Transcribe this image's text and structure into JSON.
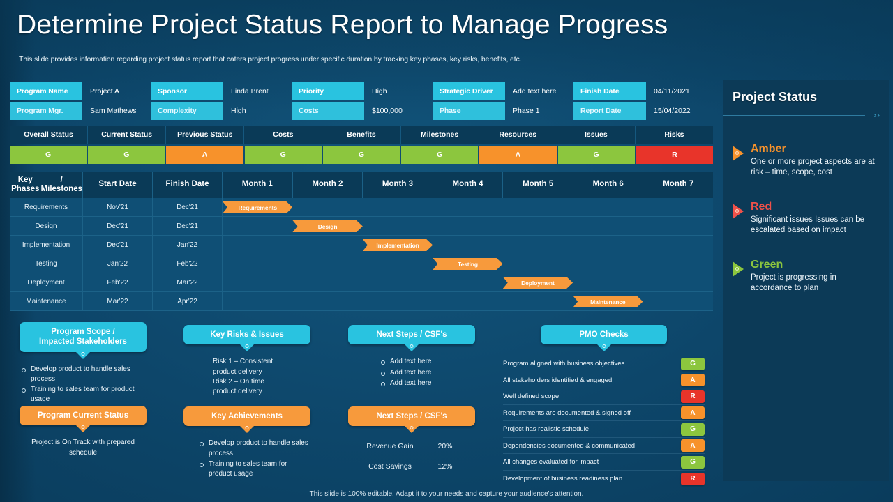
{
  "header": {
    "title": "Determine Project Status Report to Manage Progress",
    "subtitle": "This slide provides information regarding project status report that caters project progress under specific duration by tracking key phases, key risks, benefits, etc."
  },
  "info_strip": {
    "row1": [
      {
        "label": "Program Name",
        "value": "Project A"
      },
      {
        "label": "Sponsor",
        "value": "Linda Brent"
      },
      {
        "label": "Priority",
        "value": "High"
      },
      {
        "label": "Strategic Driver",
        "value": "Add text here"
      },
      {
        "label": "Finish Date",
        "value": "04/11/2021"
      }
    ],
    "row2": [
      {
        "label": "Program Mgr.",
        "value": "Sam Mathews"
      },
      {
        "label": "Complexity",
        "value": "High"
      },
      {
        "label": "Costs",
        "value": "$100,000"
      },
      {
        "label": "Phase",
        "value": "Phase 1"
      },
      {
        "label": "Report Date",
        "value": "15/04/2022"
      }
    ]
  },
  "status_table": {
    "headers": [
      "Overall Status",
      "Current Status",
      "Previous Status",
      "Costs",
      "Benefits",
      "Milestones",
      "Resources",
      "Issues",
      "Risks"
    ],
    "values": [
      "G",
      "G",
      "A",
      "G",
      "G",
      "G",
      "A",
      "G",
      "R"
    ]
  },
  "gantt": {
    "headers": [
      "Key Phases\n/ Milestones",
      "Start Date",
      "Finish Date",
      "Month 1",
      "Month 2",
      "Month 3",
      "Month 4",
      "Month 5",
      "Month 6",
      "Month 7"
    ],
    "phase_header_line1": "Key Phases",
    "phase_header_line2": "/ Milestones",
    "rows": [
      {
        "phase": "Requirements",
        "start": "Nov'21",
        "finish": "Dec'21",
        "bar_label": "Requirements",
        "bar_start_month": 1,
        "bar_span": 1
      },
      {
        "phase": "Design",
        "start": "Dec'21",
        "finish": "Dec'21",
        "bar_label": "Design",
        "bar_start_month": 2,
        "bar_span": 1
      },
      {
        "phase": "Implementation",
        "start": "Dec'21",
        "finish": "Jan'22",
        "bar_label": "Implementation",
        "bar_start_month": 3,
        "bar_span": 1
      },
      {
        "phase": "Testing",
        "start": "Jan'22",
        "finish": "Feb'22",
        "bar_label": "Testing",
        "bar_start_month": 4,
        "bar_span": 1
      },
      {
        "phase": "Deployment",
        "start": "Feb'22",
        "finish": "Mar'22",
        "bar_label": "Deployment",
        "bar_start_month": 5,
        "bar_span": 1
      },
      {
        "phase": "Maintenance",
        "start": "Mar'22",
        "finish": "Apr'22",
        "bar_label": "Maintenance",
        "bar_start_month": 6,
        "bar_span": 1
      }
    ]
  },
  "cards": {
    "program_scope": {
      "title": "Program Scope /\nImpacted Stakeholders",
      "title_line1": "Program Scope /",
      "title_line2": "Impacted Stakeholders",
      "items": [
        "Develop product to handle sales process",
        "Training to sales team for product usage"
      ]
    },
    "program_current_status": {
      "title": "Program Current Status",
      "text": "Project is On Track with prepared schedule"
    },
    "key_risks": {
      "title": "Key Risks & Issues",
      "lines": [
        "Risk 1 – Consistent",
        "product delivery",
        "Risk 2 – On time",
        "product delivery"
      ]
    },
    "key_achievements": {
      "title": "Key Achievements",
      "items": [
        "Develop product to handle sales process",
        "Training to sales team for product usage"
      ]
    },
    "next_steps_cyan": {
      "title": "Next Steps / CSF's",
      "items": [
        "Add text here",
        "Add text here",
        "Add text here"
      ]
    },
    "next_steps_orange": {
      "title": "Next Steps / CSF's",
      "metrics": [
        {
          "key": "Revenue Gain",
          "value": "20%"
        },
        {
          "key": "Cost Savings",
          "value": "12%"
        }
      ]
    },
    "pmo_checks": {
      "title": "PMO Checks",
      "items": [
        {
          "text": "Program aligned with business objectives",
          "status": "G"
        },
        {
          "text": "All stakeholders identified & engaged",
          "status": "A"
        },
        {
          "text": "Well defined scope",
          "status": "R"
        },
        {
          "text": "Requirements are documented & signed off",
          "status": "A"
        },
        {
          "text": "Project has realistic schedule",
          "status": "G"
        },
        {
          "text": "Dependencies documented & communicated",
          "status": "A"
        },
        {
          "text": "All changes evaluated for impact",
          "status": "G"
        },
        {
          "text": "Development of business readiness plan",
          "status": "R"
        }
      ]
    }
  },
  "sidebar": {
    "title": "Project Status",
    "chevrons": "››",
    "legend": [
      {
        "name": "Amber",
        "color": "#f7922b",
        "desc": "One or more project aspects are at risk – time, scope, cost"
      },
      {
        "name": "Red",
        "color": "#f0514a",
        "desc": "Significant issues Issues can be escalated based on impact"
      },
      {
        "name": "Green",
        "color": "#8cc63e",
        "desc": "Project is progressing in accordance to plan"
      }
    ]
  },
  "footer": {
    "text": "This slide is 100% editable. Adapt it to your needs and capture your audience's attention."
  },
  "colors": {
    "green": "#8cc63e",
    "amber": "#f7922b",
    "red": "#e8342a",
    "cyan": "#29c3e0",
    "orange": "#f79a3c",
    "background": "#0f4d70",
    "sidebar_bg": "#0c3a57"
  }
}
